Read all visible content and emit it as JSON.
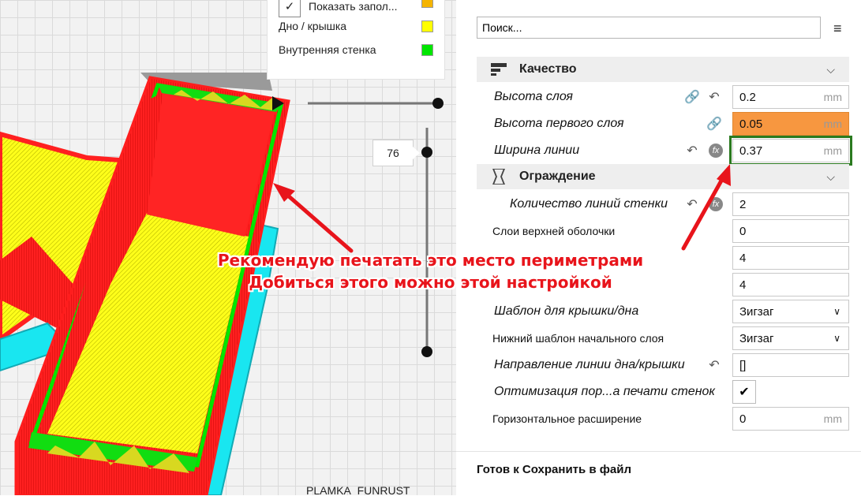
{
  "legend": {
    "items": [
      {
        "label": "Показать запол...",
        "color": "#f5b400",
        "checked": true
      },
      {
        "label": "Дно / крышка",
        "color": "#ffff00"
      },
      {
        "label": "Внутренняя стенка",
        "color": "#00e600"
      }
    ]
  },
  "layer_slider": {
    "value": "76"
  },
  "viewport_bottom_text": "PLAMKA_FUNRUST",
  "search": {
    "placeholder": "Поиск..."
  },
  "menu_icon": "≡",
  "sections": {
    "quality": {
      "title": "Качество",
      "icon": "quality-icon"
    },
    "shell": {
      "title": "Ограждение",
      "icon": "shell-icon"
    }
  },
  "settings": {
    "layer_height": {
      "label": "Высота слоя",
      "value": "0.2",
      "unit": "mm"
    },
    "initial_layer_height": {
      "label": "Высота первого слоя",
      "value": "0.05",
      "unit": "mm"
    },
    "line_width": {
      "label": "Ширина линии",
      "value": "0.37",
      "unit": "mm"
    },
    "wall_line_count": {
      "label": "Количество линий стенки",
      "value": "2"
    },
    "top_layers": {
      "label": "Слои верхней оболочки",
      "value": "0"
    },
    "row7": {
      "label": "",
      "value": "4"
    },
    "row8": {
      "label": "",
      "value": "4"
    },
    "top_bottom_pattern": {
      "label": "Шаблон для крышки/дна",
      "value": "Зигзаг"
    },
    "initial_bottom_pattern": {
      "label": "Нижний шаблон начального слоя",
      "value": "Зигзаг"
    },
    "top_bottom_direction": {
      "label": "Направление линии дна/крышки",
      "value": "[]"
    },
    "wall_order_opt": {
      "label": "Оптимизация пор...а печати стенок",
      "checked": true
    },
    "horizontal_expansion": {
      "label": "Горизонтальное расширение",
      "value": "0",
      "unit": "mm"
    }
  },
  "status": {
    "text": "Готов к Сохранить в файл"
  },
  "annotation": {
    "line1": "Рекомендую печатать это место периметрами",
    "line2": "Добиться этого можно этой настройкой"
  },
  "colors": {
    "wall": "#ff1d1d",
    "inner_wall": "#00e600",
    "skin": "#ffff00",
    "support": "#00ffff",
    "highlight": "#2a7a1f",
    "annotation": "#e8141b",
    "changed_field": "#f79740"
  }
}
